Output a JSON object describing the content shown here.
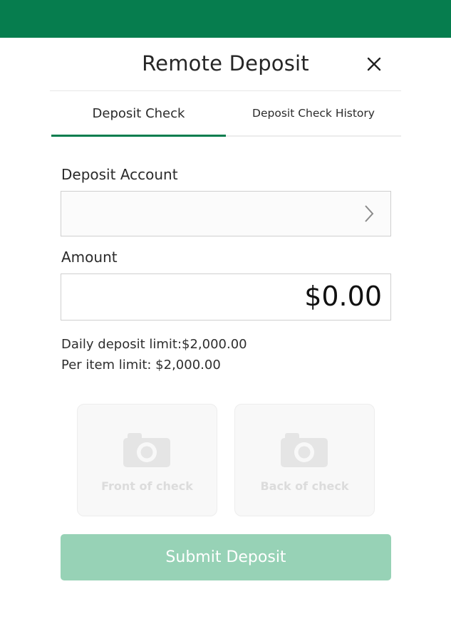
{
  "colors": {
    "brand_green": "#067d4e",
    "submit_disabled": "#97d2b6",
    "card_disabled_text": "#dcdcdc"
  },
  "header": {
    "title": "Remote Deposit",
    "close_icon": "close-icon"
  },
  "tabs": [
    {
      "label": "Deposit Check",
      "selected": true
    },
    {
      "label": "Deposit Check History",
      "selected": false
    }
  ],
  "form": {
    "account_label": "Deposit Account",
    "account_value": "",
    "account_icon": "chevron-right-icon",
    "amount_label": "Amount",
    "amount_value": "$0.00"
  },
  "limits": {
    "daily": "Daily deposit limit:$2,000.00",
    "per_item": "Per item limit: $2,000.00"
  },
  "capture": {
    "front_label": "Front of check",
    "back_label": "Back of check",
    "icon": "camera-icon",
    "enabled": false
  },
  "submit": {
    "label": "Submit Deposit",
    "enabled": false
  }
}
